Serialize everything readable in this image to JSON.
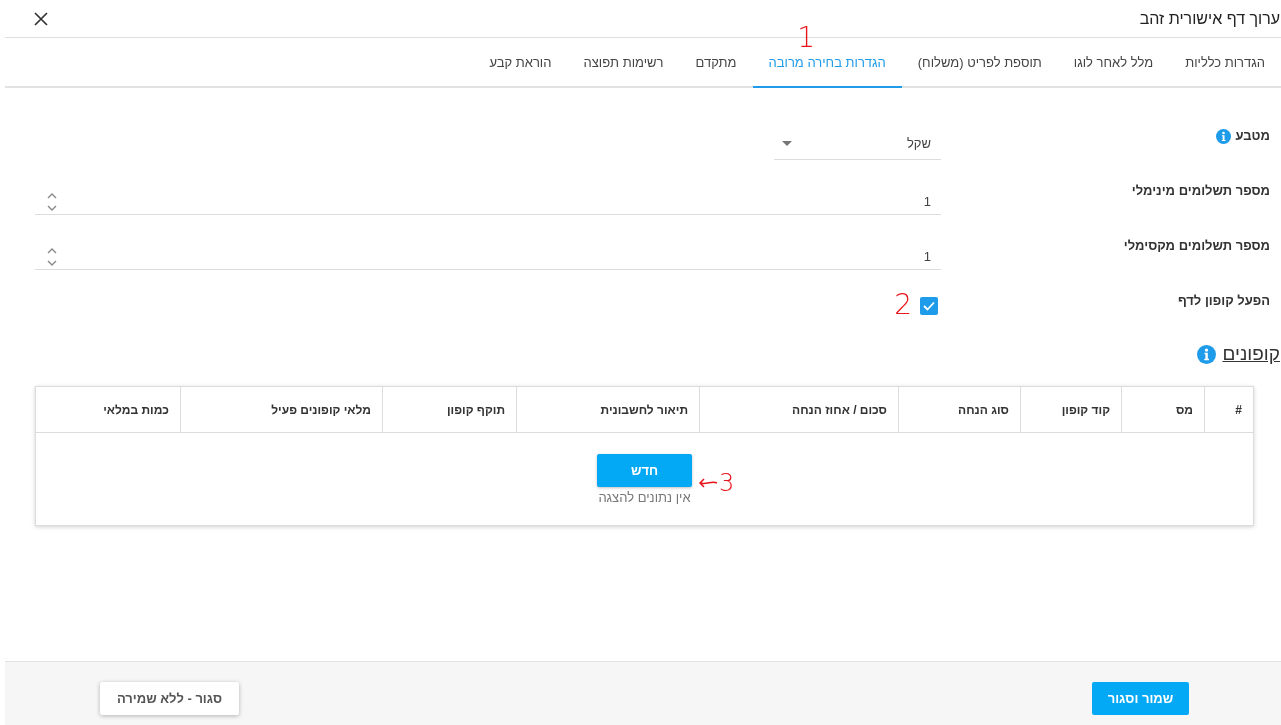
{
  "window": {
    "title": "ערוך דף אישורית זהב"
  },
  "tabs": [
    {
      "label": "הגדרות כלליות",
      "selected": false
    },
    {
      "label": "מלל לאחר לוגו",
      "selected": false
    },
    {
      "label": "תוספת לפריט (משלוח)",
      "selected": false
    },
    {
      "label": "הגדרות בחירה מרובה",
      "selected": true,
      "annotation": {
        "text": "1"
      }
    },
    {
      "label": "מתקדם",
      "selected": false
    },
    {
      "label": "רשימות תפוצה",
      "selected": false
    },
    {
      "label": "הוראת קבע",
      "selected": false
    }
  ],
  "form": {
    "fields": [
      {
        "kind": "select",
        "label": "מטבע",
        "info": true,
        "value": "שקל"
      },
      {
        "kind": "number",
        "label": "מספר תשלומים מינימלי",
        "info": false,
        "value": "1"
      },
      {
        "kind": "number",
        "label": "מספר תשלומים מקסימלי",
        "info": false,
        "value": "1"
      },
      {
        "kind": "checkbox",
        "label": "הפעל קופון לדף",
        "info": false,
        "checked": true,
        "annotation": {
          "text": "2"
        }
      }
    ]
  },
  "coupons": {
    "title": "קופונים",
    "info": true,
    "table": {
      "columns": [
        "#",
        "מס",
        "קוד קופון",
        "סוג הנחה",
        "סכום / אחוז הנחה",
        "תיאור לחשבונית",
        "תוקף קופון",
        "מלאי קופונים פעיל",
        "כמות במלאי"
      ],
      "new_button": {
        "label": "חדש",
        "annotation": {
          "text": "3",
          "arrow": true
        }
      },
      "empty_message": "אין נתונים להצגה"
    }
  },
  "footer": {
    "buttons": [
      {
        "label": "שמור וסגור",
        "kind": "primary"
      },
      {
        "label": "סגור - ללא שמירה",
        "kind": "secondary"
      }
    ]
  }
}
